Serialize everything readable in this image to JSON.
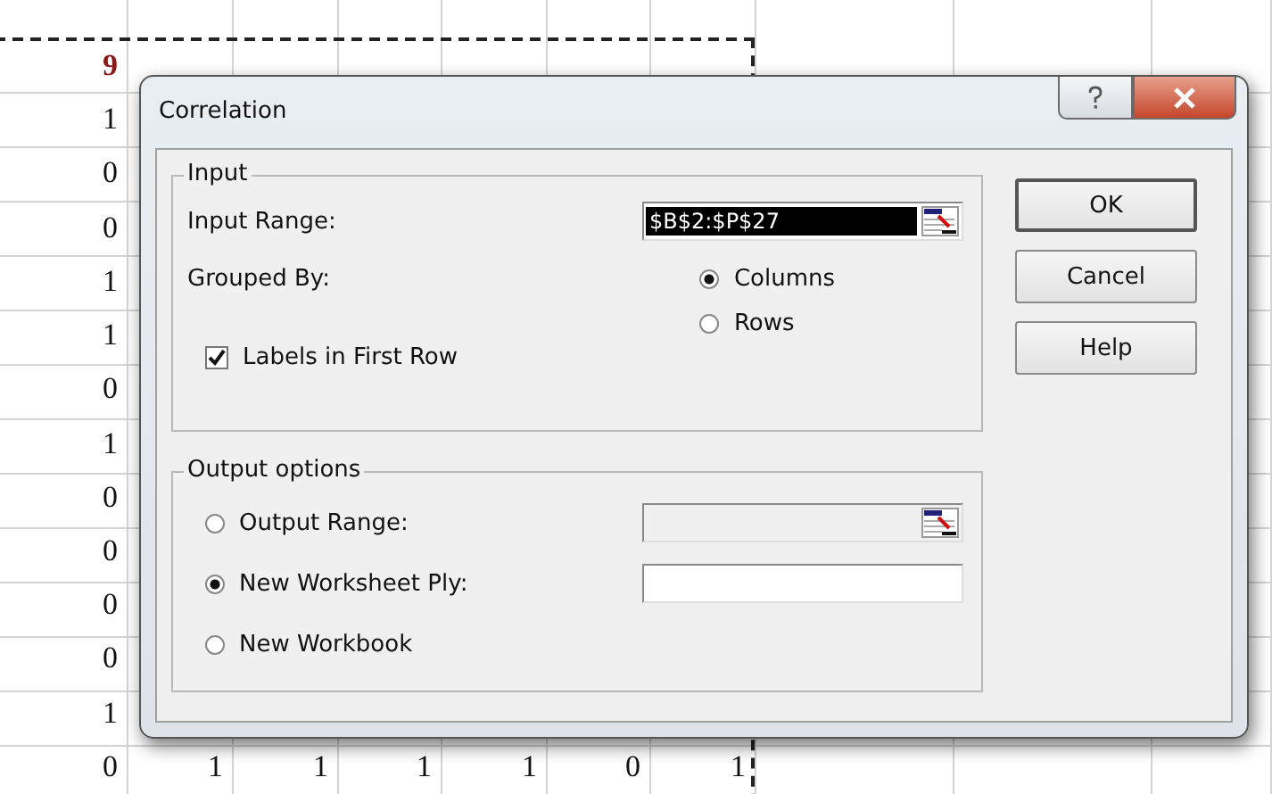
{
  "sheet": {
    "rows": [
      {
        "kind": "header",
        "cells": [
          "9"
        ]
      },
      {
        "kind": "data",
        "cells": [
          "1"
        ]
      },
      {
        "kind": "data",
        "cells": [
          "0"
        ]
      },
      {
        "kind": "data",
        "cells": [
          "0"
        ]
      },
      {
        "kind": "data",
        "cells": [
          "1"
        ]
      },
      {
        "kind": "data",
        "cells": [
          "1"
        ]
      },
      {
        "kind": "data",
        "cells": [
          "0"
        ]
      },
      {
        "kind": "data",
        "cells": [
          "1"
        ]
      },
      {
        "kind": "data",
        "cells": [
          "0"
        ]
      },
      {
        "kind": "data",
        "cells": [
          "0"
        ]
      },
      {
        "kind": "data",
        "cells": [
          "0"
        ]
      },
      {
        "kind": "data",
        "cells": [
          "0"
        ]
      },
      {
        "kind": "data",
        "cells": [
          "1"
        ]
      },
      {
        "kind": "data",
        "cells": [
          "0",
          "1",
          "1",
          "1",
          "1",
          "0",
          "1"
        ]
      }
    ]
  },
  "dialog": {
    "title": "Correlation",
    "input_group": {
      "legend": "Input",
      "input_range": {
        "label": "Input Range:",
        "value": "$B$2:$P$27",
        "selected": true
      },
      "grouped_by": {
        "label": "Grouped By:",
        "options": [
          {
            "label": "Columns",
            "selected": true
          },
          {
            "label": "Rows",
            "selected": false
          }
        ]
      },
      "labels_checkbox": {
        "label": "Labels in First Row",
        "checked": true
      }
    },
    "output_group": {
      "legend": "Output options",
      "options": [
        {
          "label": "Output Range:",
          "selected": false,
          "kind": "range"
        },
        {
          "label": "New Worksheet Ply:",
          "selected": true,
          "kind": "text"
        },
        {
          "label": "New Workbook",
          "selected": false,
          "kind": "none"
        }
      ]
    },
    "buttons": [
      {
        "label": "OK",
        "default": true
      },
      {
        "label": "Cancel",
        "default": false
      },
      {
        "label": "Help",
        "default": false
      }
    ]
  }
}
